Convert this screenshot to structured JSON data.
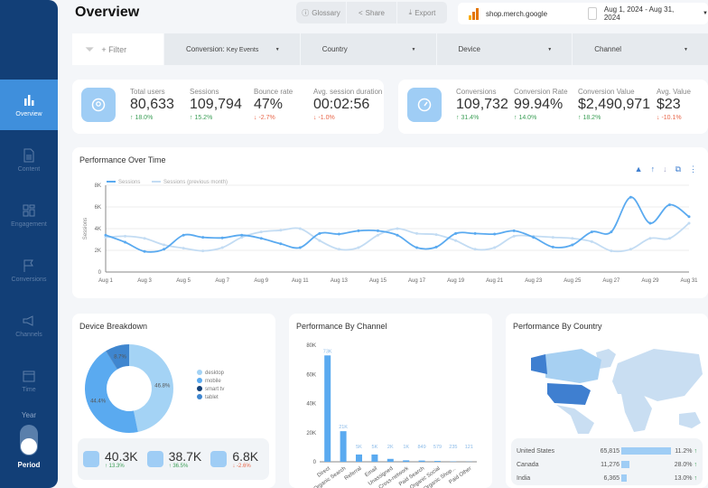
{
  "sidebar": {
    "items": [
      {
        "label": "Overview",
        "icon": "bar-chart-icon",
        "active": true
      },
      {
        "label": "Content",
        "icon": "document-icon"
      },
      {
        "label": "Engagement",
        "icon": "dashboard-icon"
      },
      {
        "label": "Conversions",
        "icon": "flag-icon"
      },
      {
        "label": "Channels",
        "icon": "megaphone-icon"
      },
      {
        "label": "Time",
        "icon": "calendar-icon"
      }
    ],
    "toggle_top": "Year",
    "toggle_bottom": "Period"
  },
  "header": {
    "title": "Overview",
    "buttons": [
      "Glossary",
      "Share",
      "Export"
    ],
    "site": "shop.merch.google",
    "date_range": "Aug 1, 2024 - Aug 31, 2024"
  },
  "filters": {
    "add": "+ Filter",
    "dropdowns": [
      {
        "label": "Conversion:",
        "value": "Key Events"
      },
      {
        "label": "Country",
        "value": ""
      },
      {
        "label": "Device",
        "value": ""
      },
      {
        "label": "Channel",
        "value": ""
      }
    ]
  },
  "kpis_left": [
    {
      "label": "Total users",
      "value": "80,633",
      "delta": "18.0%",
      "dir": "up"
    },
    {
      "label": "Sessions",
      "value": "109,794",
      "delta": "15.2%",
      "dir": "up"
    },
    {
      "label": "Bounce rate",
      "value": "47%",
      "delta": "-2.7%",
      "dir": "dn"
    },
    {
      "label": "Avg. session duration",
      "value": "00:02:56",
      "delta": "-1.0%",
      "dir": "dn"
    }
  ],
  "kpis_right": [
    {
      "label": "Conversions",
      "value": "109,732",
      "delta": "31.4%",
      "dir": "up"
    },
    {
      "label": "Conversion Rate",
      "value": "99.94%",
      "delta": "14.0%",
      "dir": "up"
    },
    {
      "label": "Conversion Value",
      "value": "$2,490,971",
      "delta": "18.2%",
      "dir": "up"
    },
    {
      "label": "Avg. Value",
      "value": "$23",
      "delta": "-10.1%",
      "dir": "dn"
    }
  ],
  "colors": {
    "sidebar": "#123f77",
    "accent": "#3f8fdc",
    "series1": "#5aaaf0",
    "series2": "#c3dcf3",
    "up": "#3a9e55",
    "down": "#e8674a"
  },
  "chart_data": [
    {
      "type": "line",
      "title": "Performance Over Time",
      "ylabel": "Sessions",
      "ylim": [
        0,
        8000
      ],
      "yticks": [
        "0",
        "2K",
        "4K",
        "6K",
        "8K"
      ],
      "x": [
        "Aug 1",
        "Aug 2",
        "Aug 3",
        "Aug 4",
        "Aug 5",
        "Aug 6",
        "Aug 7",
        "Aug 8",
        "Aug 9",
        "Aug 10",
        "Aug 11",
        "Aug 12",
        "Aug 13",
        "Aug 14",
        "Aug 15",
        "Aug 16",
        "Aug 17",
        "Aug 18",
        "Aug 19",
        "Aug 20",
        "Aug 21",
        "Aug 22",
        "Aug 23",
        "Aug 24",
        "Aug 25",
        "Aug 26",
        "Aug 27",
        "Aug 28",
        "Aug 29",
        "Aug 30",
        "Aug 31"
      ],
      "series": [
        {
          "name": "Sessions",
          "values": [
            3400,
            2750,
            1900,
            2100,
            3400,
            3200,
            3150,
            3400,
            3100,
            2600,
            2250,
            3550,
            3500,
            3800,
            3800,
            3400,
            2250,
            2300,
            3550,
            3550,
            3500,
            3800,
            3200,
            2300,
            2500,
            3700,
            3700,
            6900,
            4500,
            6200,
            5100
          ]
        },
        {
          "name": "Sessions (previous month)",
          "values": [
            3200,
            3300,
            3100,
            2500,
            2200,
            1950,
            2250,
            3200,
            3700,
            3850,
            4000,
            2900,
            2100,
            2250,
            3400,
            4000,
            3550,
            3450,
            2900,
            2100,
            2250,
            3300,
            3300,
            3200,
            3100,
            2800,
            1950,
            2100,
            3100,
            3100,
            4500
          ]
        }
      ],
      "grid": true,
      "legend": "top-left"
    },
    {
      "type": "pie",
      "title": "Device Breakdown",
      "categories": [
        "desktop",
        "mobile",
        "smart tv",
        "tablet"
      ],
      "values": [
        46.8,
        44.4,
        0.1,
        8.7
      ],
      "labels": [
        "46.8%",
        "44.4%",
        "",
        "8.7%"
      ],
      "legend": "right"
    },
    {
      "type": "bar",
      "title": "Performance By Channel",
      "ylim": [
        0,
        80000
      ],
      "yticks": [
        "0",
        "20K",
        "40K",
        "60K",
        "80K"
      ],
      "categories": [
        "Direct",
        "Organic Search",
        "Referral",
        "Email",
        "Unassigned",
        "Cross-network",
        "Paid Search",
        "Organic Social",
        "Organic Shop...",
        "Paid Other"
      ],
      "values": [
        73000,
        21000,
        5000,
        5000,
        2000,
        1000,
        849,
        579,
        235,
        121
      ],
      "labels": [
        "73K",
        "21K",
        "5K",
        "5K",
        "2K",
        "1K",
        "849",
        "579",
        "235",
        "121"
      ]
    }
  ],
  "device_stats": [
    {
      "icon": "desktop-icon",
      "value": "40.3K",
      "delta": "13.3%",
      "dir": "up"
    },
    {
      "icon": "mobile-icon",
      "value": "38.7K",
      "delta": "36.5%",
      "dir": "up"
    },
    {
      "icon": "tablet-icon",
      "value": "6.8K",
      "delta": "-2.6%",
      "dir": "dn"
    }
  ],
  "country": {
    "title": "Performance By Country",
    "rows": [
      {
        "name": "United States",
        "value": "65,815",
        "share": 1,
        "delta": "11.2%"
      },
      {
        "name": "Canada",
        "value": "11,276",
        "share": 0.17,
        "delta": "28.0%"
      },
      {
        "name": "India",
        "value": "6,365",
        "share": 0.1,
        "delta": "13.0%"
      }
    ]
  }
}
